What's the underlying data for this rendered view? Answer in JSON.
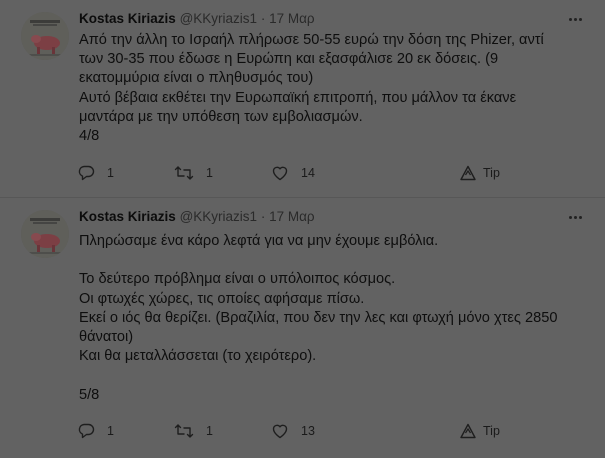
{
  "tweets": [
    {
      "author": {
        "name": "Kostas Kiriazis",
        "handle": "@KKyriazis1",
        "time": "17 Μαρ"
      },
      "lines": [
        "Από την άλλη το Ισραήλ πλήρωσε 50-55 ευρώ την δόση της Phizer, αντί",
        "των 30-35 που έδωσε η Ευρώπη και εξασφάλισε 20 εκ δόσεις. (9",
        "εκατομμύρια είναι ο πληθυσμός του)",
        "Αυτό βέβαια εκθέτει την Ευρωπαϊκή επιτροπή, που μάλλον τα έκανε",
        "μαντάρα με την υπόθεση των εμβολιασμών.",
        "4/8"
      ],
      "replies": "1",
      "retweets": "1",
      "likes": "14",
      "tip_label": "Tip"
    },
    {
      "author": {
        "name": "Kostas Kiriazis",
        "handle": "@KKyriazis1",
        "time": "17 Μαρ"
      },
      "lines": [
        "Πληρώσαμε ένα κάρο λεφτά για να μην έχουμε εμβόλια.",
        "",
        "Το δεύτερο πρόβλημα είναι ο υπόλοιπος κόσμος.",
        "Οι φτωχές χώρες, τις οποίες αφήσαμε πίσω.",
        "Εκεί ο ιός θα θερίζει. (Βραζιλία, που δεν την λες και φτωχή μόνο χτες 2850",
        "θάνατοι)",
        "Και θα μεταλλάσσεται (το χειρότερο).",
        "",
        "5/8"
      ],
      "replies": "1",
      "retweets": "1",
      "likes": "13",
      "tip_label": "Tip"
    }
  ],
  "icons": {
    "reply": "reply-icon",
    "retweet": "retweet-icon",
    "like": "heart-icon",
    "tip": "tip-icon",
    "more": "more-options-icon"
  },
  "colors": {
    "background": "#626262",
    "text": "#0e0e0e",
    "divider": "#575757"
  }
}
